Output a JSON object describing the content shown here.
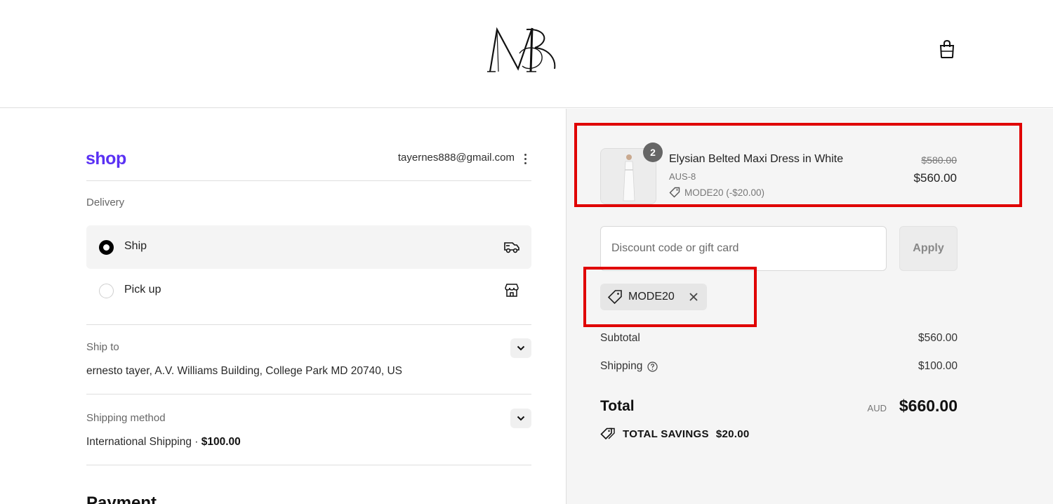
{
  "header": {
    "logo_alt": "MB",
    "cart_icon": "shopping-bag-icon"
  },
  "account": {
    "shop_brand": "shop",
    "email": "tayernes888@gmail.com",
    "menu_icon": "kebab-menu-icon"
  },
  "delivery": {
    "label": "Delivery",
    "options": [
      {
        "label": "Ship",
        "selected": true,
        "icon": "truck-icon"
      },
      {
        "label": "Pick up",
        "selected": false,
        "icon": "store-icon"
      }
    ]
  },
  "ship_to": {
    "label": "Ship to",
    "address": "ernesto tayer, A.V. Williams Building, College Park MD 20740, US"
  },
  "shipping_method": {
    "label": "Shipping method",
    "name": "International Shipping · ",
    "price": "$100.00"
  },
  "payment": {
    "title": "Payment"
  },
  "order": {
    "item": {
      "quantity": "2",
      "name": "Elysian Belted Maxi Dress in White",
      "variant": "AUS-8",
      "discount": "MODE20 (-$20.00)",
      "original_price": "$580.00",
      "price": "$560.00"
    },
    "discount_input": {
      "placeholder": "Discount code or gift card",
      "value": ""
    },
    "apply_label": "Apply",
    "applied_code": "MODE20",
    "subtotal_label": "Subtotal",
    "subtotal": "$560.00",
    "shipping_label": "Shipping",
    "shipping": "$100.00",
    "total_label": "Total",
    "currency": "AUD",
    "total": "$660.00",
    "savings_label": "TOTAL SAVINGS",
    "savings": "$20.00"
  },
  "colors": {
    "shop_brand": "#5a31f4",
    "annotation": "#e00000",
    "summary_bg": "#f5f5f5"
  }
}
